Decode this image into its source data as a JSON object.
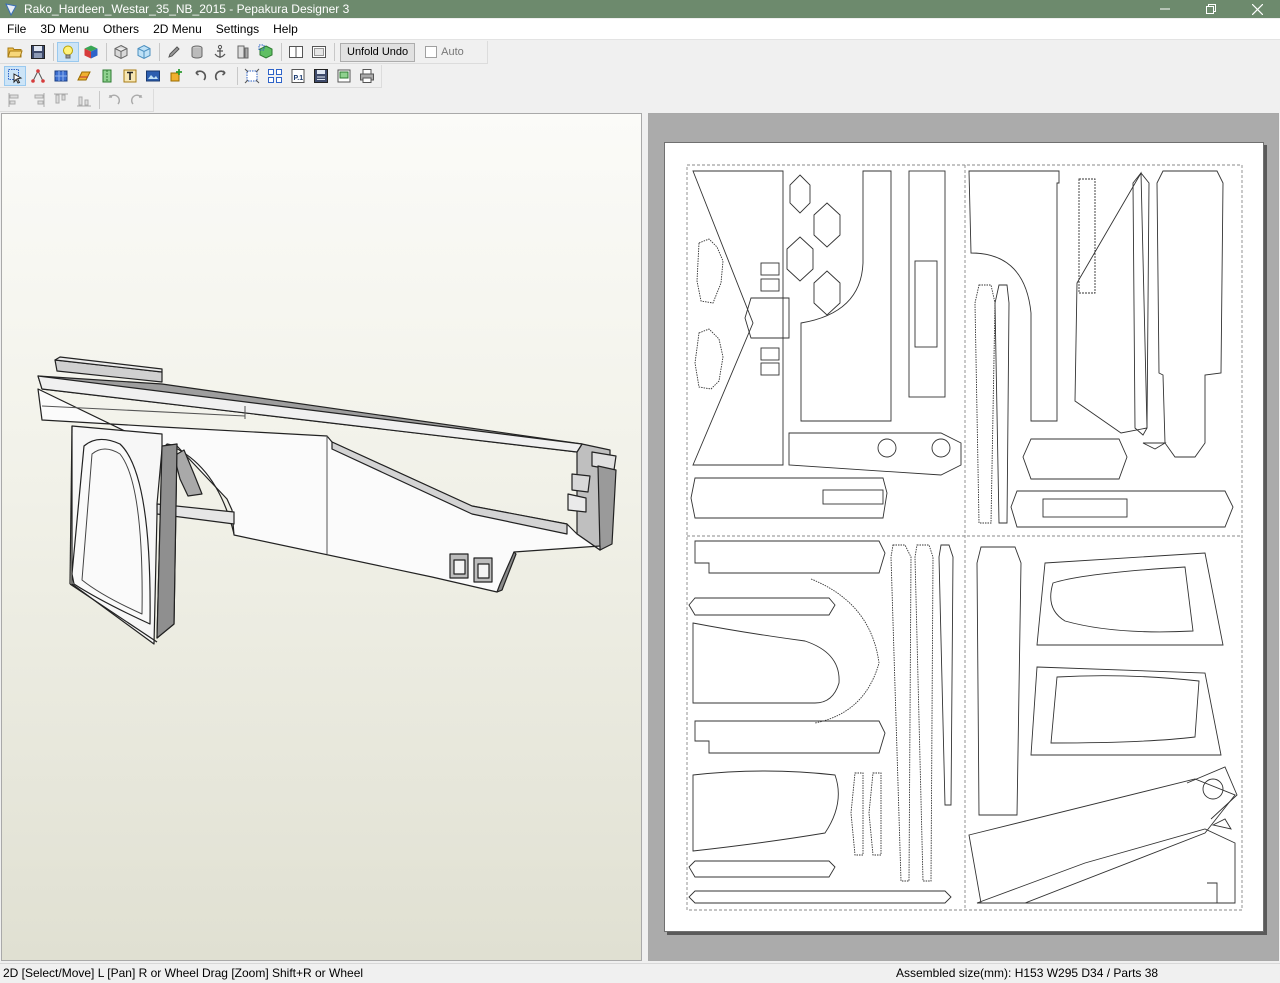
{
  "window": {
    "title": "Rako_Hardeen_Westar_35_NB_2015 - Pepakura Designer 3"
  },
  "menu": [
    "File",
    "3D Menu",
    "Others",
    "2D Menu",
    "Settings",
    "Help"
  ],
  "toolbar1": {
    "buttons": [
      "open-file",
      "save",
      "light",
      "color-cube",
      "show-faces",
      "show-textures",
      "edit-lines",
      "box-view",
      "anchor",
      "cylinder-view",
      "move-part",
      "single-pane",
      "dual-pane"
    ],
    "unfold_undo_label": "Unfold Undo",
    "auto_label": "Auto",
    "auto_checked": false
  },
  "toolbar2": {
    "buttons": [
      "select-move",
      "join-edges",
      "texture",
      "edit-flaps",
      "fold-lines",
      "text-tool",
      "image-tool",
      "add-part",
      "undo",
      "redo",
      "fit-page",
      "arrange-parts",
      "page-number",
      "print-setup",
      "export-image",
      "print"
    ]
  },
  "toolbar3": {
    "buttons": [
      "align-left",
      "align-center",
      "align-top",
      "align-middle",
      "rotate-90-ccw",
      "rotate-90-cw"
    ]
  },
  "statusbar": {
    "left": "2D [Select/Move] L [Pan] R or Wheel Drag [Zoom] Shift+R or Wheel",
    "right": "Assembled size(mm): H153 W295 D34 / Parts 38"
  },
  "colors": {
    "titlebar": "#6d8a6d",
    "selected_button": "#cce4f7",
    "pane_border": "#a9a9a9",
    "unfold_area": "#ababab"
  }
}
